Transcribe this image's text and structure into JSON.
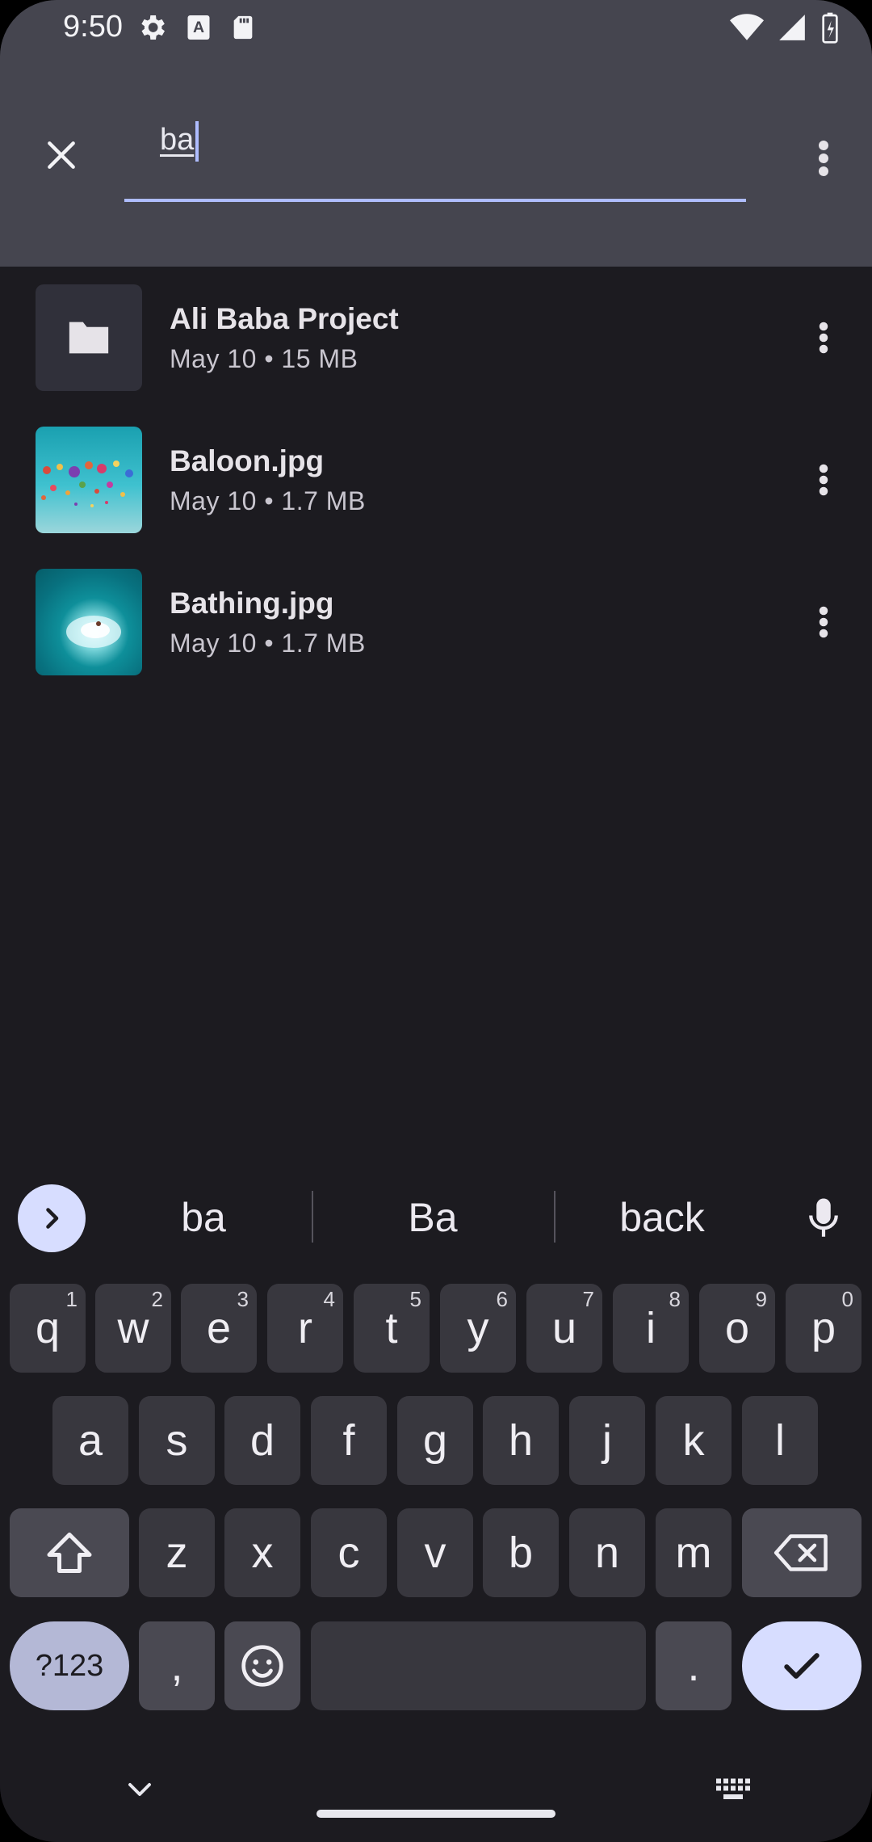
{
  "status_bar": {
    "time": "9:50",
    "icons": [
      "gear-icon",
      "a-text-icon",
      "sd-card-icon"
    ],
    "right_icons": [
      "wifi-icon",
      "signal-icon",
      "battery-icon"
    ]
  },
  "search": {
    "query": "ba"
  },
  "results": [
    {
      "title": "Ali Baba Project",
      "meta": "May 10 • 15 MB",
      "kind": "folder"
    },
    {
      "title": "Baloon.jpg",
      "meta": "May 10 • 1.7 MB",
      "kind": "image"
    },
    {
      "title": "Bathing.jpg",
      "meta": "May 10 • 1.7 MB",
      "kind": "image"
    }
  ],
  "keyboard": {
    "suggestions": [
      "ba",
      "Ba",
      "back"
    ],
    "row1": [
      {
        "k": "q",
        "h": "1"
      },
      {
        "k": "w",
        "h": "2"
      },
      {
        "k": "e",
        "h": "3"
      },
      {
        "k": "r",
        "h": "4"
      },
      {
        "k": "t",
        "h": "5"
      },
      {
        "k": "y",
        "h": "6"
      },
      {
        "k": "u",
        "h": "7"
      },
      {
        "k": "i",
        "h": "8"
      },
      {
        "k": "o",
        "h": "9"
      },
      {
        "k": "p",
        "h": "0"
      }
    ],
    "row2": [
      "a",
      "s",
      "d",
      "f",
      "g",
      "h",
      "j",
      "k",
      "l"
    ],
    "row3": [
      "z",
      "x",
      "c",
      "v",
      "b",
      "n",
      "m"
    ],
    "symbols_label": "?123",
    "comma": ",",
    "period": "."
  },
  "colors": {
    "header_bg": "#45454f",
    "screen_bg": "#1c1b20",
    "accent": "#aebcff",
    "key_bg": "#38373e"
  }
}
